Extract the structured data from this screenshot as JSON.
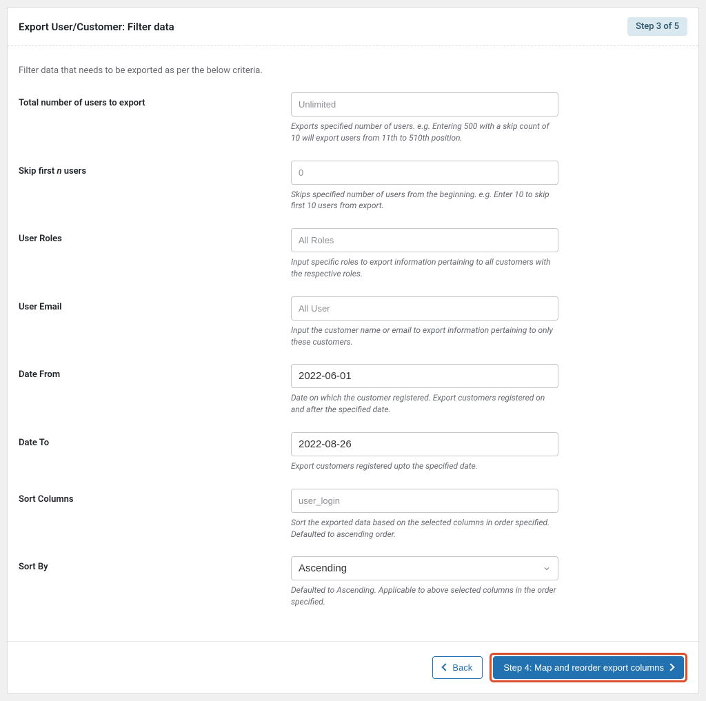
{
  "header": {
    "title": "Export User/Customer: Filter data",
    "step_badge": "Step 3 of 5"
  },
  "intro": "Filter data that needs to be exported as per the below criteria.",
  "fields": {
    "total": {
      "label": "Total number of users to export",
      "placeholder": "Unlimited",
      "value": "",
      "help": "Exports specified number of users. e.g. Entering 500 with a skip count of 10 will export users from 11th to 510th position."
    },
    "skip": {
      "label_prefix": "Skip first ",
      "label_em": "n",
      "label_suffix": " users",
      "placeholder": "0",
      "value": "",
      "help": "Skips specified number of users from the beginning. e.g. Enter 10 to skip first 10 users from export."
    },
    "roles": {
      "label": "User Roles",
      "placeholder": "All Roles",
      "value": "",
      "help": "Input specific roles to export information pertaining to all customers with the respective roles."
    },
    "email": {
      "label": "User Email",
      "placeholder": "All User",
      "value": "",
      "help": "Input the customer name or email to export information pertaining to only these customers."
    },
    "date_from": {
      "label": "Date From",
      "value": "2022-06-01",
      "help": "Date on which the customer registered. Export customers registered on and after the specified date."
    },
    "date_to": {
      "label": "Date To",
      "value": "2022-08-26",
      "help": "Export customers registered upto the specified date."
    },
    "sort_columns": {
      "label": "Sort Columns",
      "placeholder": "user_login",
      "value": "",
      "help": "Sort the exported data based on the selected columns in order specified. Defaulted to ascending order."
    },
    "sort_by": {
      "label": "Sort By",
      "value": "Ascending",
      "help": "Defaulted to Ascending. Applicable to above selected columns in the order specified."
    }
  },
  "footer": {
    "back": "Back",
    "next": "Step 4: Map and reorder export columns"
  }
}
